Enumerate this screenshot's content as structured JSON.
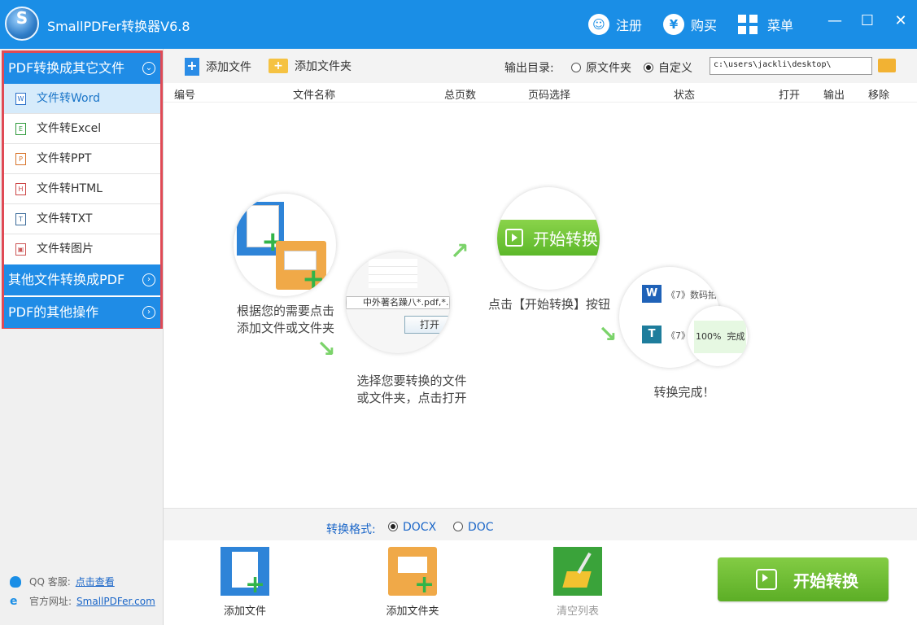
{
  "window": {
    "title": "SmallPDFer转换器V6.8",
    "register_label": "注册",
    "buy_label": "购买",
    "menu_label": "菜单",
    "minimize": "—",
    "maximize": "☐",
    "close": "✕"
  },
  "sidebar": {
    "categories": [
      {
        "label": "PDF转换成其它文件"
      },
      {
        "label": "其他文件转换成PDF"
      },
      {
        "label": "PDF的其他操作"
      }
    ],
    "items": [
      {
        "label": "文件转Word",
        "glyph": "W"
      },
      {
        "label": "文件转Excel",
        "glyph": "E"
      },
      {
        "label": "文件转PPT",
        "glyph": "P"
      },
      {
        "label": "文件转HTML",
        "glyph": "H"
      },
      {
        "label": "文件转TXT",
        "glyph": "T"
      },
      {
        "label": "文件转图片",
        "glyph": "▣"
      }
    ],
    "qq_label": "QQ 客服:",
    "qq_link": "点击查看",
    "site_label": "官方网址:",
    "site_link": "SmallPDFer.com"
  },
  "toolbar": {
    "add_file": "添加文件",
    "add_folder": "添加文件夹",
    "output_label": "输出目录:",
    "opt_original": "原文件夹",
    "opt_custom": "自定义",
    "path_value": "c:\\users\\jackli\\desktop\\"
  },
  "table": {
    "columns": [
      "编号",
      "文件名称",
      "总页数",
      "页码选择",
      "状态",
      "打开",
      "输出",
      "移除"
    ]
  },
  "guide": {
    "step1_line1": "根据您的需要点击",
    "step1_line2": "添加文件或文件夹",
    "step2_line1": "选择您要转换的文件",
    "step2_line2": "或文件夹，点击打开",
    "step2_file": "中外著名躁八*.pdf,*.",
    "step2_open": "打开",
    "step3_line1": "点击【开始转换】按钮",
    "step3_button": "开始转换",
    "step4_line1": "转换完成！",
    "step4_row1": "《7》数码拍",
    "step4_row2": "《7》",
    "step4_progress": "100%",
    "step4_done": "完成"
  },
  "format": {
    "label": "转换格式:",
    "opt_docx": "DOCX",
    "opt_doc": "DOC"
  },
  "bottom": {
    "add_file": "添加文件",
    "add_folder": "添加文件夹",
    "clear_list": "清空列表",
    "start": "开始转换"
  }
}
